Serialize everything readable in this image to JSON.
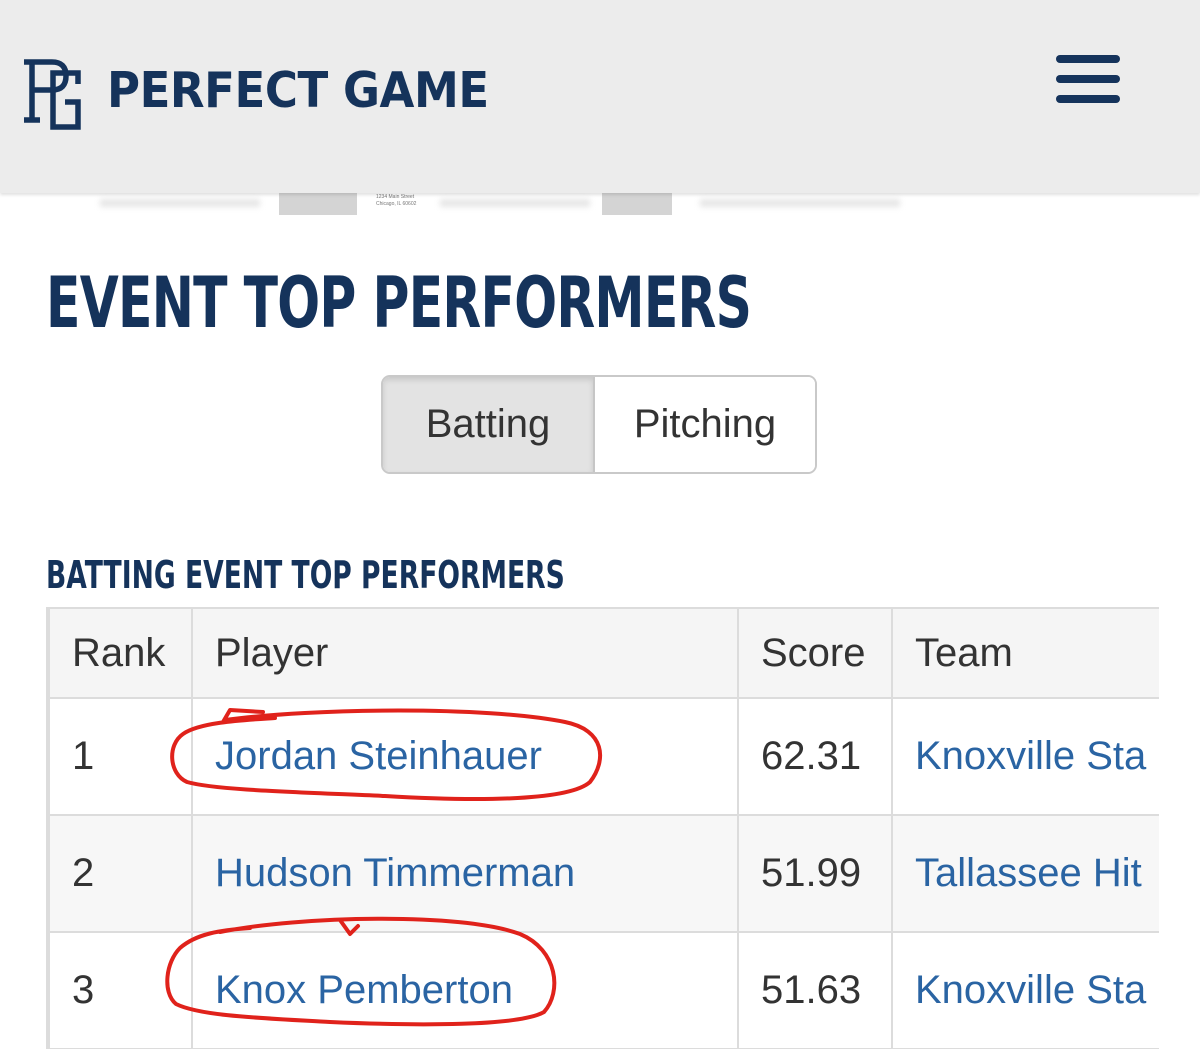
{
  "header": {
    "brand": "PERFECT GAME",
    "logo_icon": "pg-logo-icon",
    "menu_icon": "hamburger-menu-icon"
  },
  "ad_banner": {
    "address": "1234 Main Street\nChicago, IL 60602"
  },
  "page_title": "EVENT TOP PERFORMERS",
  "tabs": [
    {
      "label": "Batting",
      "active": true
    },
    {
      "label": "Pitching",
      "active": false
    }
  ],
  "section_title": "BATTING EVENT TOP PERFORMERS",
  "table": {
    "columns": [
      "Rank",
      "Player",
      "Score",
      "Team"
    ],
    "rows": [
      {
        "rank": "1",
        "player": "Jordan Steinhauer",
        "score": "62.31",
        "team": "Knoxville Sta"
      },
      {
        "rank": "2",
        "player": "Hudson Timmerman",
        "score": "51.99",
        "team": "Tallassee Hit"
      },
      {
        "rank": "3",
        "player": "Knox Pemberton",
        "score": "51.63",
        "team": "Knoxville Sta"
      }
    ]
  },
  "colors": {
    "brand_navy": "#15335b",
    "link_blue": "#2a64a3",
    "annotation_red": "#e0221b"
  }
}
